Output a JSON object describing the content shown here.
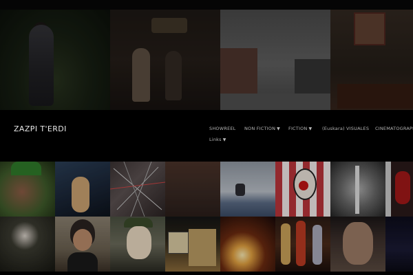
{
  "site": {
    "title": "ZAZPI T'ERDI"
  },
  "nav": {
    "items": [
      {
        "label": "SHOWREEL",
        "has_dropdown": false
      },
      {
        "label": "NON FICTION",
        "has_dropdown": true
      },
      {
        "label": "FICTION",
        "has_dropdown": true
      },
      {
        "label": "(Euskara) VISUALES",
        "has_dropdown": false
      },
      {
        "label": "CINEMATOGRAPHY",
        "has_dropdown": false
      },
      {
        "label": "Links",
        "has_dropdown": true
      }
    ]
  },
  "hero": {
    "tiles": [
      {
        "icon": "forest-figure-image"
      },
      {
        "icon": "interior-couple-image"
      },
      {
        "icon": "winter-street-image"
      },
      {
        "icon": "mao-portrait-room-image"
      }
    ]
  },
  "gallery": {
    "rows": [
      [
        "man-green-cap-image",
        "dancer-motion-image",
        "scratched-lines-image",
        "dark-texture-image",
        "jumping-figure-image",
        "red-mask-face-image",
        "xray-chest-image",
        "red-bars-image"
      ],
      [
        "dark-blossom-image",
        "child-portrait-image",
        "man-glasses-hat-image",
        "framed-poster-image",
        "fire-spark-image",
        "carnival-dancers-image",
        "man-closeup-image",
        "blue-dark-image"
      ]
    ]
  },
  "colors": {
    "background": "#000000",
    "title": "#e8e8e8",
    "nav": "#b5b5b5"
  }
}
